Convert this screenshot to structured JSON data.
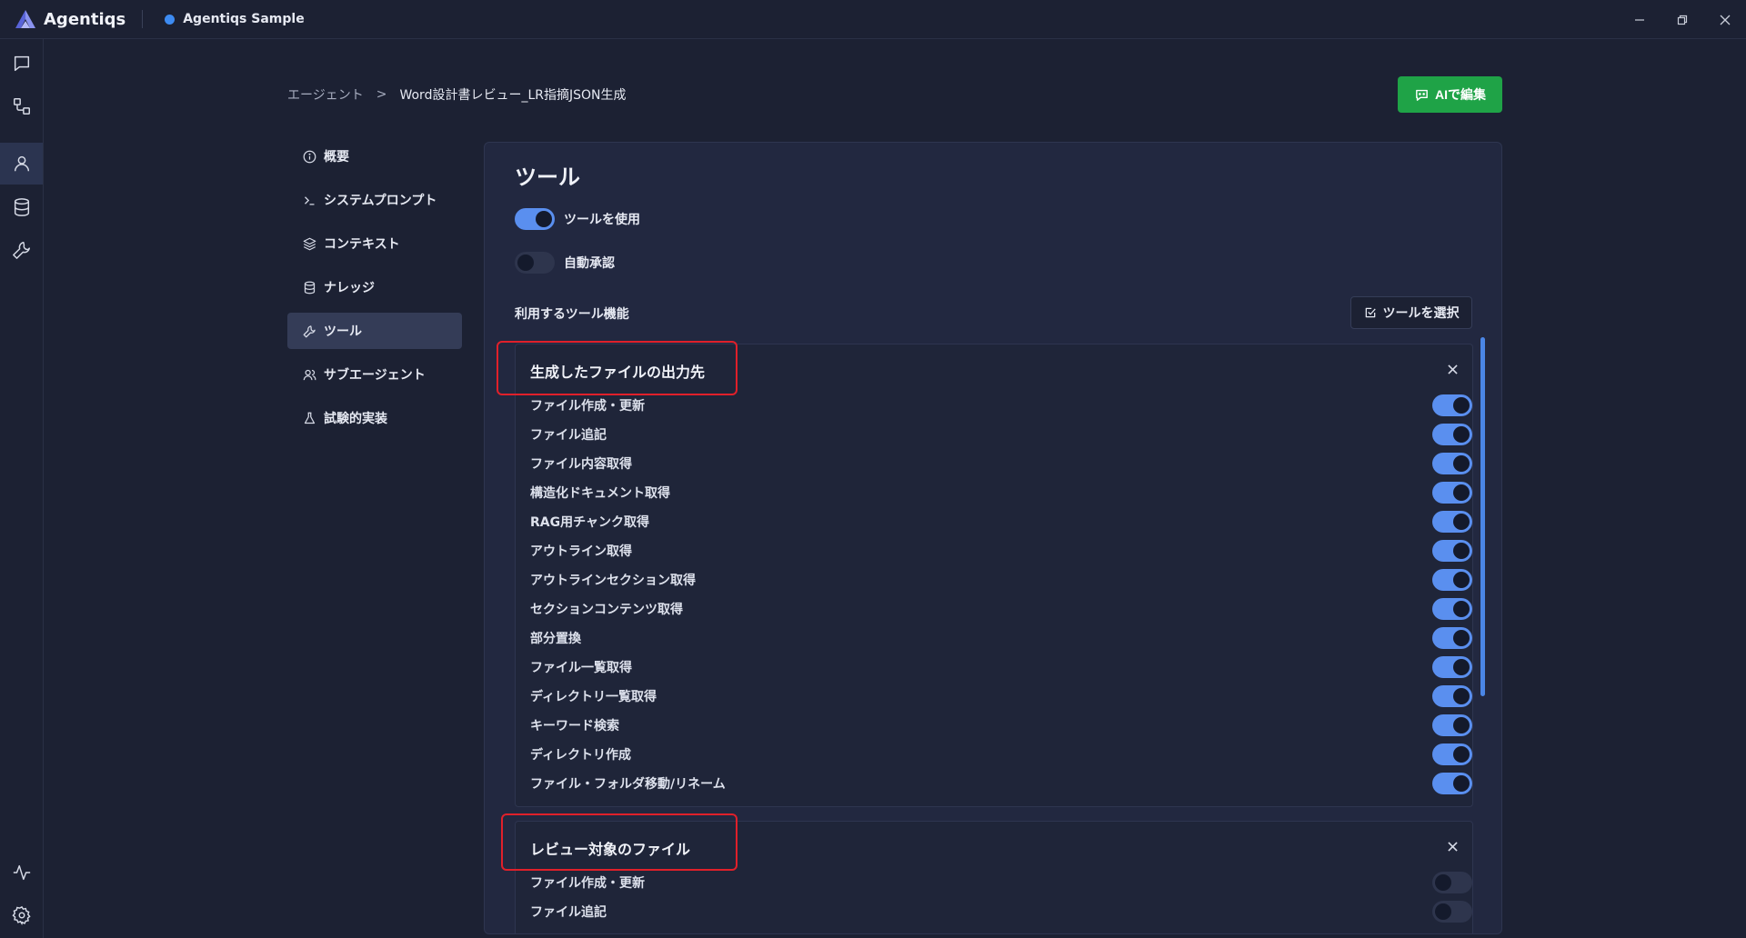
{
  "app": {
    "name": "Agentiqs",
    "workspace": "Agentiqs Sample"
  },
  "colors": {
    "accent": "#5a8fef",
    "primary_button": "#1fa347",
    "highlight": "#e0202a",
    "background": "#1c2133"
  },
  "breadcrumb": {
    "root": "エージェント",
    "separator": ">",
    "current": "Word設計書レビュー_LR指摘JSON生成"
  },
  "header": {
    "ai_edit_label": "AIで編集"
  },
  "nav": {
    "items": [
      {
        "label": "概要",
        "icon": "info-icon"
      },
      {
        "label": "システムプロンプト",
        "icon": "terminal-icon"
      },
      {
        "label": "コンテキスト",
        "icon": "layers-icon"
      },
      {
        "label": "ナレッジ",
        "icon": "database-icon"
      },
      {
        "label": "ツール",
        "icon": "wrench-icon",
        "active": true
      },
      {
        "label": "サブエージェント",
        "icon": "users-icon"
      },
      {
        "label": "試験的実装",
        "icon": "flask-icon"
      }
    ]
  },
  "panel": {
    "title": "ツール",
    "use_tools": {
      "label": "ツールを使用",
      "on": true
    },
    "auto_approve": {
      "label": "自動承認",
      "on": false
    },
    "section_label": "利用するツール機能",
    "select_tools_label": "ツールを選択"
  },
  "groups": [
    {
      "title": "生成したファイルの出力先",
      "tools": [
        {
          "name": "ファイル作成・更新",
          "on": true
        },
        {
          "name": "ファイル追記",
          "on": true
        },
        {
          "name": "ファイル内容取得",
          "on": true
        },
        {
          "name": "構造化ドキュメント取得",
          "on": true
        },
        {
          "name": "RAG用チャンク取得",
          "on": true
        },
        {
          "name": "アウトライン取得",
          "on": true
        },
        {
          "name": "アウトラインセクション取得",
          "on": true
        },
        {
          "name": "セクションコンテンツ取得",
          "on": true
        },
        {
          "name": "部分置換",
          "on": true
        },
        {
          "name": "ファイル一覧取得",
          "on": true
        },
        {
          "name": "ディレクトリ一覧取得",
          "on": true
        },
        {
          "name": "キーワード検索",
          "on": true
        },
        {
          "name": "ディレクトリ作成",
          "on": true
        },
        {
          "name": "ファイル・フォルダ移動/リネーム",
          "on": true
        }
      ]
    },
    {
      "title": "レビュー対象のファイル",
      "tools": [
        {
          "name": "ファイル作成・更新",
          "on": false
        },
        {
          "name": "ファイル追記",
          "on": false
        }
      ]
    }
  ]
}
